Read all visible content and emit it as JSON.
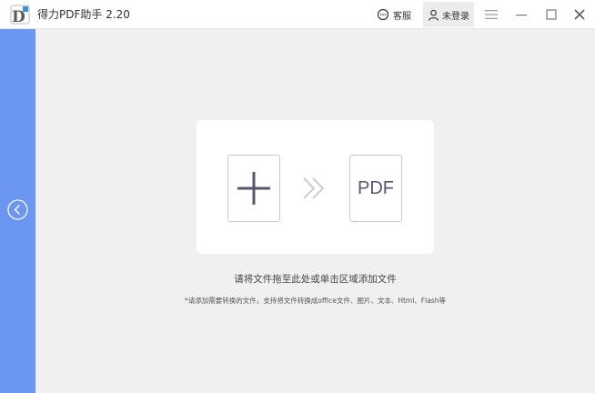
{
  "app": {
    "title": "得力PDF助手 2.20"
  },
  "header": {
    "service_label": "客服",
    "login_label": "未登录"
  },
  "icons": {
    "logo": "app-logo-icon",
    "service": "chat-bubble-icon",
    "login": "user-icon",
    "menu": "hamburger-menu-icon",
    "minimize": "minimize-icon",
    "maximize": "maximize-icon",
    "close": "close-icon",
    "collapse": "chevron-left-circle-icon",
    "add": "plus-icon",
    "arrow": "double-chevron-right-icon"
  },
  "dropzone": {
    "target_label": "PDF",
    "hint": "请将文件拖至此处或单击区域添加文件",
    "note": "*请添加需要转换的文件，支持将文件转换成office文件、图片、文本、Html、Flash等"
  },
  "colors": {
    "sidebar": "#6b96f2",
    "background": "#f0f0f0",
    "card": "#ffffff",
    "icon_dark": "#595472"
  }
}
